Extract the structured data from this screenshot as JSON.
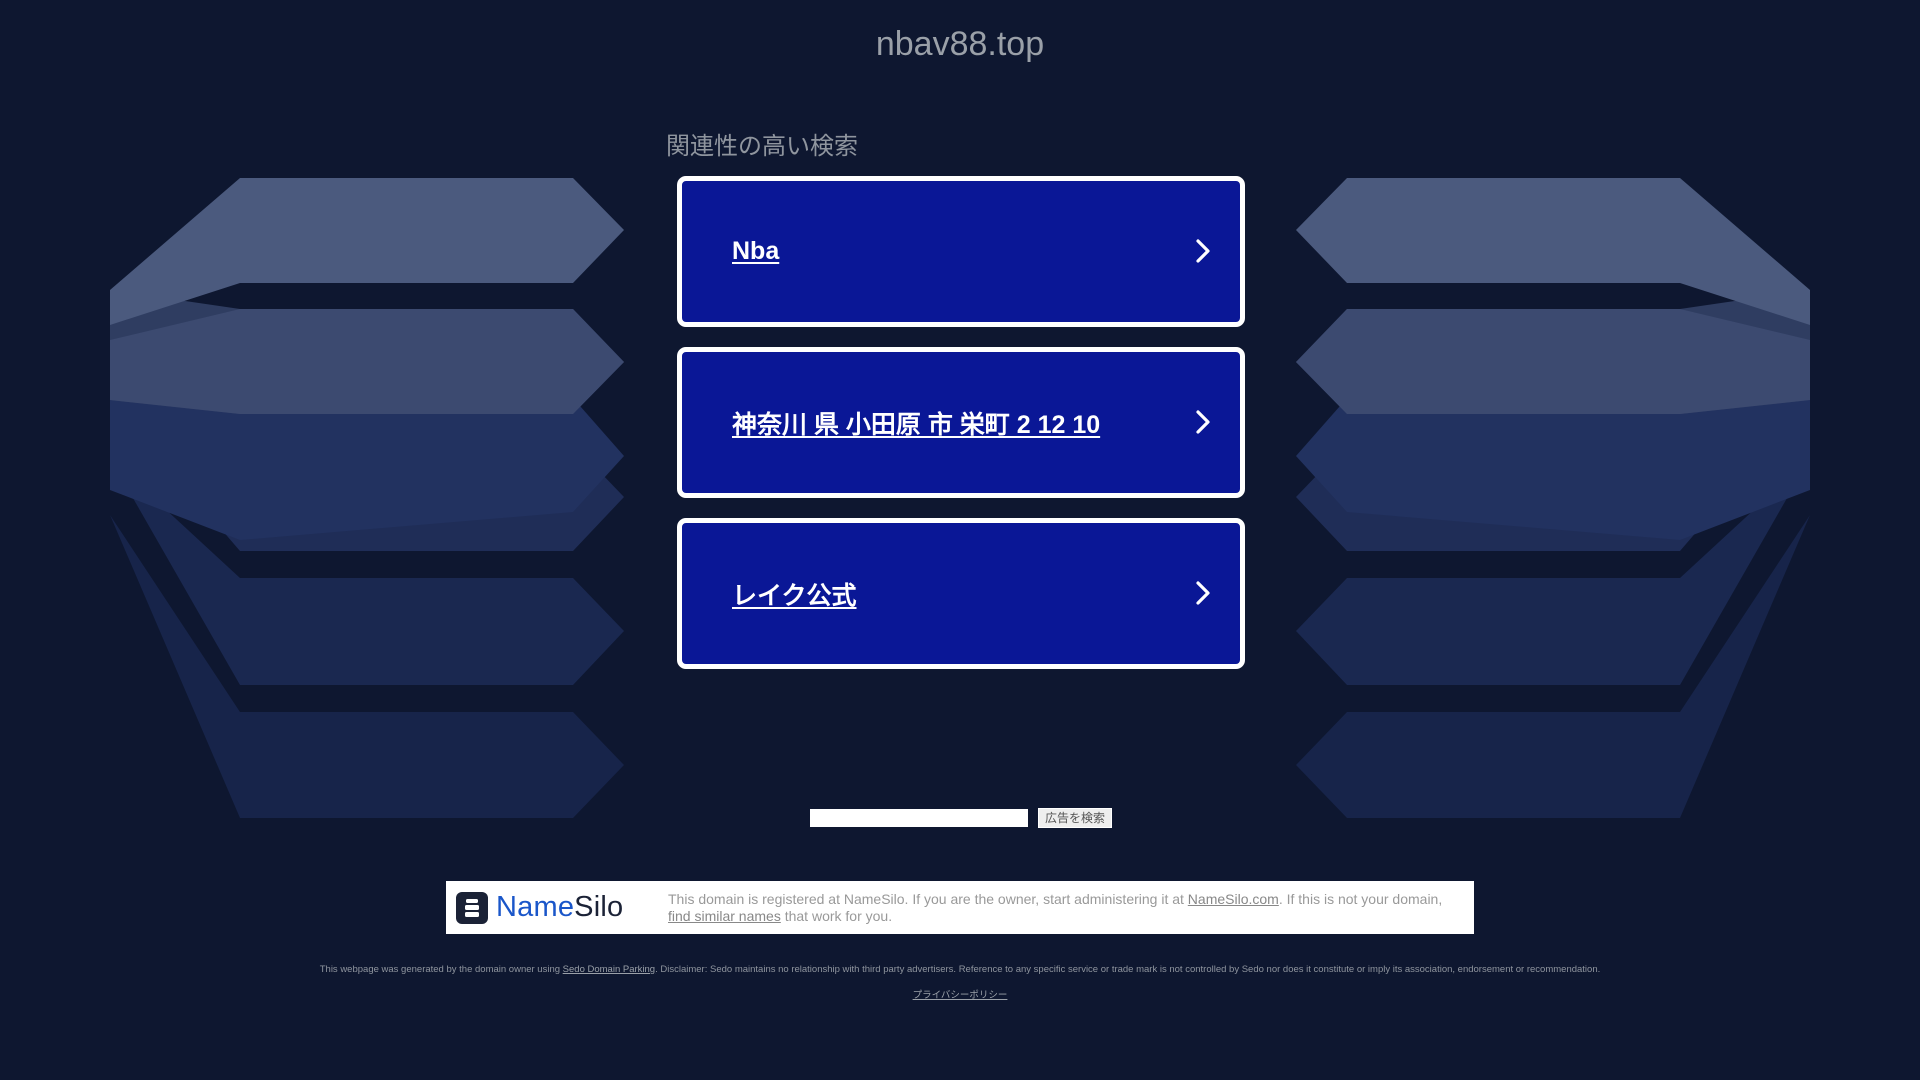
{
  "domain_title": "nbav88.top",
  "related_heading": "関連性の高い検索",
  "results": [
    {
      "label": "Nba"
    },
    {
      "label": "神奈川 県 小田原 市 栄町 2 12 10"
    },
    {
      "label": "レイク公式"
    }
  ],
  "ad_search": {
    "input_value": "",
    "button_label": "広告を検索"
  },
  "namesilo": {
    "logo_name": "Name",
    "logo_silo": "Silo",
    "text_before": "This domain is registered at NameSilo. If you are the owner, start administering it at ",
    "link1": "NameSilo.com",
    "text_mid": ". If this is not your domain, ",
    "link2": "find similar names",
    "text_after": " that work for you."
  },
  "disclaimer": {
    "before": "This webpage was generated by the domain owner using ",
    "link": "Sedo Domain Parking",
    "after": ". Disclaimer: Sedo maintains no relationship with third party advertisers. Reference to any specific service or trade mark is not controlled by Sedo nor does it constitute or imply its association, endorsement or recommendation."
  },
  "privacy_link": "プライバシーポリシー",
  "colors": {
    "background": "#0e1730",
    "card": "#0a1796",
    "card_border": "#ffffff",
    "shape_light": "#4b5a7e",
    "shape_mid": "#2f3d61",
    "shape_dark": "#17244a"
  },
  "icons": {
    "chevron": "chevron-right-icon",
    "logo": "namesilo-logo-icon"
  }
}
